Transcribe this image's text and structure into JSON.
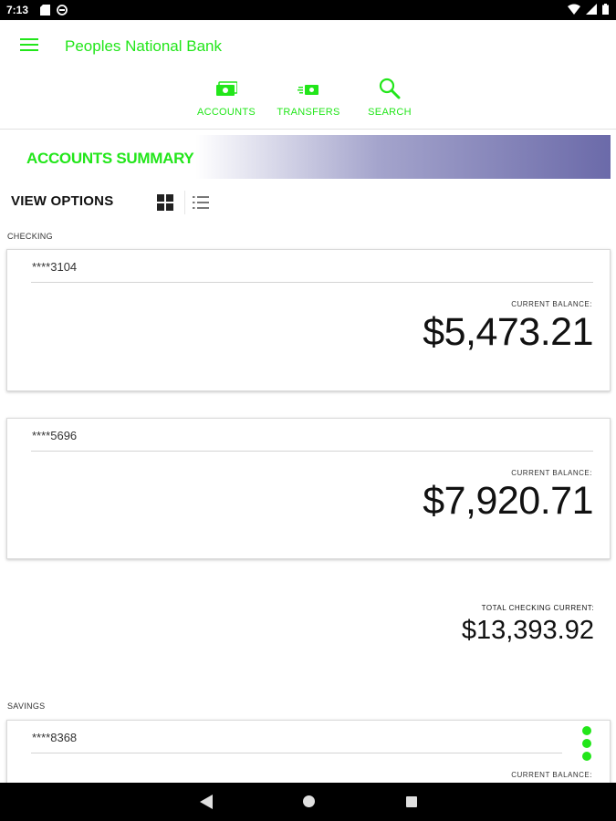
{
  "status_bar": {
    "time": "7:13",
    "icons": [
      "sim-card-icon",
      "do-not-disturb-icon",
      "wifi-icon",
      "signal-icon",
      "battery-icon"
    ]
  },
  "app_bar": {
    "title": "Peoples National Bank",
    "menu_icon": "hamburger-menu-icon",
    "tabs": [
      {
        "label": "ACCOUNTS",
        "icon": "accounts-icon"
      },
      {
        "label": "TRANSFERS",
        "icon": "transfers-icon"
      },
      {
        "label": "SEARCH",
        "icon": "search-icon"
      }
    ]
  },
  "summary": {
    "title": "ACCOUNTS SUMMARY",
    "view_options_label": "VIEW OPTIONS",
    "view_modes": [
      {
        "name": "grid",
        "icon": "grid-view-icon",
        "selected": true
      },
      {
        "name": "list",
        "icon": "list-view-icon",
        "selected": false
      }
    ]
  },
  "checking": {
    "section_label": "CHECKING",
    "accounts": [
      {
        "number": "****3104",
        "balance_label": "CURRENT BALANCE:",
        "balance": "$5,473.21"
      },
      {
        "number": "****5696",
        "balance_label": "CURRENT BALANCE:",
        "balance": "$7,920.71"
      }
    ],
    "total_label": "TOTAL CHECKING CURRENT:",
    "total": "$13,393.92"
  },
  "savings": {
    "section_label": "SAVINGS",
    "accounts": [
      {
        "number": "****8368",
        "balance_label": "CURRENT BALANCE:"
      }
    ]
  },
  "colors": {
    "accent": "#22e61a",
    "banner_gradient_end": "#6b6aa9",
    "status_bar": "#000000"
  }
}
